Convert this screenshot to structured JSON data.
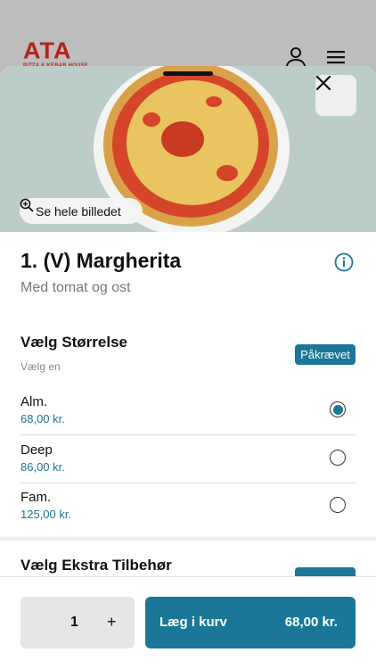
{
  "brand": {
    "logo_text": "ATA",
    "logo_sub": "PIZZA & KEBAB HOUSE"
  },
  "product": {
    "title": "1. (V) Margherita",
    "description": "Med tomat og ost",
    "see_image_label": "Se hele billedet"
  },
  "size_section": {
    "title": "Vælg Størrelse",
    "subtitle": "Vælg en",
    "badge": "Påkrævet",
    "options": [
      {
        "name": "Alm.",
        "price": "68,00 kr.",
        "selected": true
      },
      {
        "name": "Deep",
        "price": "86,00 kr.",
        "selected": false
      },
      {
        "name": "Fam.",
        "price": "125,00 kr.",
        "selected": false
      }
    ]
  },
  "extras_section": {
    "title": "Vælg Ekstra Tilbehør"
  },
  "footer": {
    "quantity": "1",
    "plus": "+",
    "add_label": "Læg i kurv",
    "add_price": "68,00 kr."
  },
  "colors": {
    "accent": "#1b7797",
    "brand_red": "#b4241c"
  },
  "icons": {
    "user": "user-icon",
    "menu": "hamburger-menu-icon",
    "close": "close-icon",
    "zoom": "zoom-in-icon",
    "info": "info-icon"
  }
}
